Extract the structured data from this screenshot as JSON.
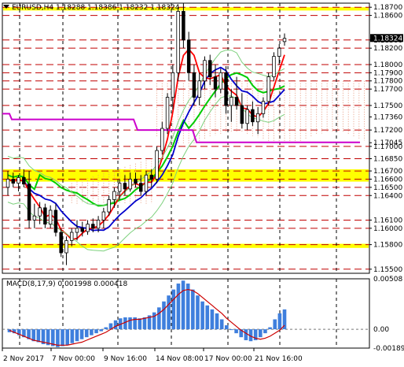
{
  "header": {
    "symbol_text": "EURUSD,H4  1.18288 1.18386 1.18232 1.18324",
    "menu_icon": "triangle-down-icon"
  },
  "macd_header": "MACD(8,17,9) 0.001998 0.000418",
  "colors": {
    "background": "#ffffff",
    "resistance_line": "#c00000",
    "support_band": "#ffff00",
    "ma_fast": "#ff0000",
    "ma_slow": "#0000cc",
    "ma_trend": "#00cc00",
    "ma_long": "#cc00cc",
    "bollinger": "#7cd07c",
    "cloud_dots": "#e89a80",
    "macd_hist": "#3f7fdd",
    "macd_signal": "#cc0000",
    "current_price_box": "#000000"
  },
  "chart_data": {
    "type": "candlestick",
    "symbol": "EURUSD",
    "timeframe": "H4",
    "ohlc_header": {
      "open": 1.18288,
      "high": 1.18386,
      "low": 1.18232,
      "close": 1.18324
    },
    "ylim": [
      1.1545,
      1.1875
    ],
    "price_axis_labels": [
      "1.18700",
      "1.18600",
      "1.18300",
      "1.18200",
      "1.18000",
      "1.17900",
      "1.17800",
      "1.17700",
      "1.17500",
      "1.17360",
      "1.17200",
      "1.17045",
      "1.17000",
      "1.16850",
      "1.16700",
      "1.16600",
      "1.16500",
      "1.16400",
      "1.16100",
      "1.16000",
      "1.15800",
      "1.15500"
    ],
    "current_price_label": "1.18324",
    "horizontal_levels": [
      1.187,
      1.186,
      1.183,
      1.182,
      1.18,
      1.179,
      1.178,
      1.177,
      1.175,
      1.172,
      1.17,
      1.1685,
      1.167,
      1.166,
      1.165,
      1.164,
      1.161,
      1.16,
      1.158,
      1.155
    ],
    "support_bands": [
      [
        1.1866,
        1.187
      ],
      [
        1.1657,
        1.1672
      ],
      [
        1.1576,
        1.1581
      ]
    ],
    "time_labels": [
      "2 Nov 2017",
      "7 Nov 00:00",
      "9 Nov 16:00",
      "14 Nov 08:00",
      "17 Nov 00:00",
      "21 Nov 16:00"
    ],
    "candles": [
      [
        1.165,
        1.167,
        1.164,
        1.166
      ],
      [
        1.166,
        1.1668,
        1.165,
        1.1655
      ],
      [
        1.1655,
        1.1665,
        1.1645,
        1.1662
      ],
      [
        1.1662,
        1.1672,
        1.165,
        1.1654
      ],
      [
        1.1654,
        1.167,
        1.16,
        1.161
      ],
      [
        1.161,
        1.163,
        1.16,
        1.1615
      ],
      [
        1.1615,
        1.1632,
        1.1605,
        1.1625
      ],
      [
        1.1625,
        1.163,
        1.16,
        1.1605
      ],
      [
        1.1605,
        1.1628,
        1.16,
        1.1622
      ],
      [
        1.1622,
        1.163,
        1.159,
        1.1595
      ],
      [
        1.1595,
        1.16,
        1.1565,
        1.157
      ],
      [
        1.157,
        1.159,
        1.1555,
        1.1585
      ],
      [
        1.1585,
        1.16,
        1.1578,
        1.1595
      ],
      [
        1.1595,
        1.161,
        1.1585,
        1.16
      ],
      [
        1.16,
        1.1608,
        1.159,
        1.1596
      ],
      [
        1.1596,
        1.161,
        1.1592,
        1.1605
      ],
      [
        1.1605,
        1.1612,
        1.1595,
        1.16
      ],
      [
        1.16,
        1.1615,
        1.1595,
        1.161
      ],
      [
        1.161,
        1.1625,
        1.16,
        1.162
      ],
      [
        1.162,
        1.164,
        1.1615,
        1.1635
      ],
      [
        1.1635,
        1.165,
        1.1625,
        1.1645
      ],
      [
        1.1645,
        1.166,
        1.1635,
        1.1655
      ],
      [
        1.1655,
        1.1665,
        1.164,
        1.1648
      ],
      [
        1.1648,
        1.1668,
        1.1645,
        1.166
      ],
      [
        1.166,
        1.1668,
        1.165,
        1.1655
      ],
      [
        1.1655,
        1.1665,
        1.164,
        1.1645
      ],
      [
        1.1645,
        1.167,
        1.164,
        1.1665
      ],
      [
        1.1665,
        1.1672,
        1.165,
        1.166
      ],
      [
        1.166,
        1.17,
        1.1655,
        1.1695
      ],
      [
        1.1695,
        1.173,
        1.169,
        1.1722
      ],
      [
        1.1722,
        1.1765,
        1.1715,
        1.176
      ],
      [
        1.176,
        1.18,
        1.1745,
        1.179
      ],
      [
        1.179,
        1.187,
        1.178,
        1.1865
      ],
      [
        1.1865,
        1.1875,
        1.182,
        1.183
      ],
      [
        1.183,
        1.184,
        1.178,
        1.179
      ],
      [
        1.179,
        1.18,
        1.175,
        1.176
      ],
      [
        1.176,
        1.179,
        1.175,
        1.178
      ],
      [
        1.178,
        1.181,
        1.177,
        1.1805
      ],
      [
        1.1805,
        1.1812,
        1.1775,
        1.1785
      ],
      [
        1.1785,
        1.18,
        1.176,
        1.177
      ],
      [
        1.177,
        1.1795,
        1.1765,
        1.179
      ],
      [
        1.179,
        1.1798,
        1.174,
        1.175
      ],
      [
        1.175,
        1.177,
        1.173,
        1.176
      ],
      [
        1.176,
        1.1785,
        1.1745,
        1.175
      ],
      [
        1.175,
        1.1765,
        1.1722,
        1.1728
      ],
      [
        1.1728,
        1.175,
        1.172,
        1.1745
      ],
      [
        1.1745,
        1.1755,
        1.1725,
        1.173
      ],
      [
        1.173,
        1.1748,
        1.1715,
        1.174
      ],
      [
        1.174,
        1.176,
        1.1735,
        1.1755
      ],
      [
        1.1755,
        1.179,
        1.175,
        1.1785
      ],
      [
        1.1785,
        1.1815,
        1.178,
        1.181
      ],
      [
        1.181,
        1.1825,
        1.18,
        1.182
      ],
      [
        1.1828,
        1.1838,
        1.1823,
        1.1832
      ]
    ],
    "macd": {
      "ylim": [
        -0.001896,
        0.00508
      ],
      "axis_labels": [
        "0.00508",
        "0.00",
        "-0.001896"
      ],
      "histogram": [
        -0.0003,
        -0.0004,
        -0.0006,
        -0.0008,
        -0.001,
        -0.0012,
        -0.0013,
        -0.0015,
        -0.0016,
        -0.0017,
        -0.0018,
        -0.0017,
        -0.0016,
        -0.0014,
        -0.0012,
        -0.001,
        -0.0008,
        -0.0006,
        -0.0004,
        -0.0002,
        0.0002,
        0.0006,
        0.0009,
        0.0011,
        0.0012,
        0.0012,
        0.0012,
        0.0011,
        0.0012,
        0.0014,
        0.0017,
        0.0022,
        0.0028,
        0.0034,
        0.004,
        0.0046,
        0.0049,
        0.0046,
        0.004,
        0.0034,
        0.0028,
        0.0024,
        0.002,
        0.0016,
        0.001,
        0.0004,
        0.0,
        -0.0004,
        -0.0008,
        -0.0011,
        -0.0012,
        -0.0011,
        -0.0008,
        -0.0004,
        0.0002,
        0.001,
        0.0016,
        0.002
      ],
      "signal": [
        -0.0001,
        -0.0003,
        -0.0005,
        -0.0007,
        -0.0009,
        -0.0011,
        -0.0012,
        -0.0013,
        -0.0014,
        -0.0015,
        -0.0016,
        -0.0016,
        -0.0016,
        -0.0015,
        -0.0014,
        -0.0013,
        -0.0011,
        -0.0009,
        -0.0007,
        -0.0005,
        -0.0003,
        0.0,
        0.0003,
        0.0005,
        0.0007,
        0.0009,
        0.001,
        0.001,
        0.0011,
        0.0012,
        0.0013,
        0.0016,
        0.002,
        0.0025,
        0.003,
        0.0035,
        0.0039,
        0.004,
        0.0039,
        0.0036,
        0.0032,
        0.0028,
        0.0024,
        0.002,
        0.0016,
        0.0011,
        0.0007,
        0.0003,
        -0.0001,
        -0.0004,
        -0.0007,
        -0.0009,
        -0.001,
        -0.0009,
        -0.0007,
        -0.0004,
        -0.0001,
        0.0004
      ]
    }
  }
}
